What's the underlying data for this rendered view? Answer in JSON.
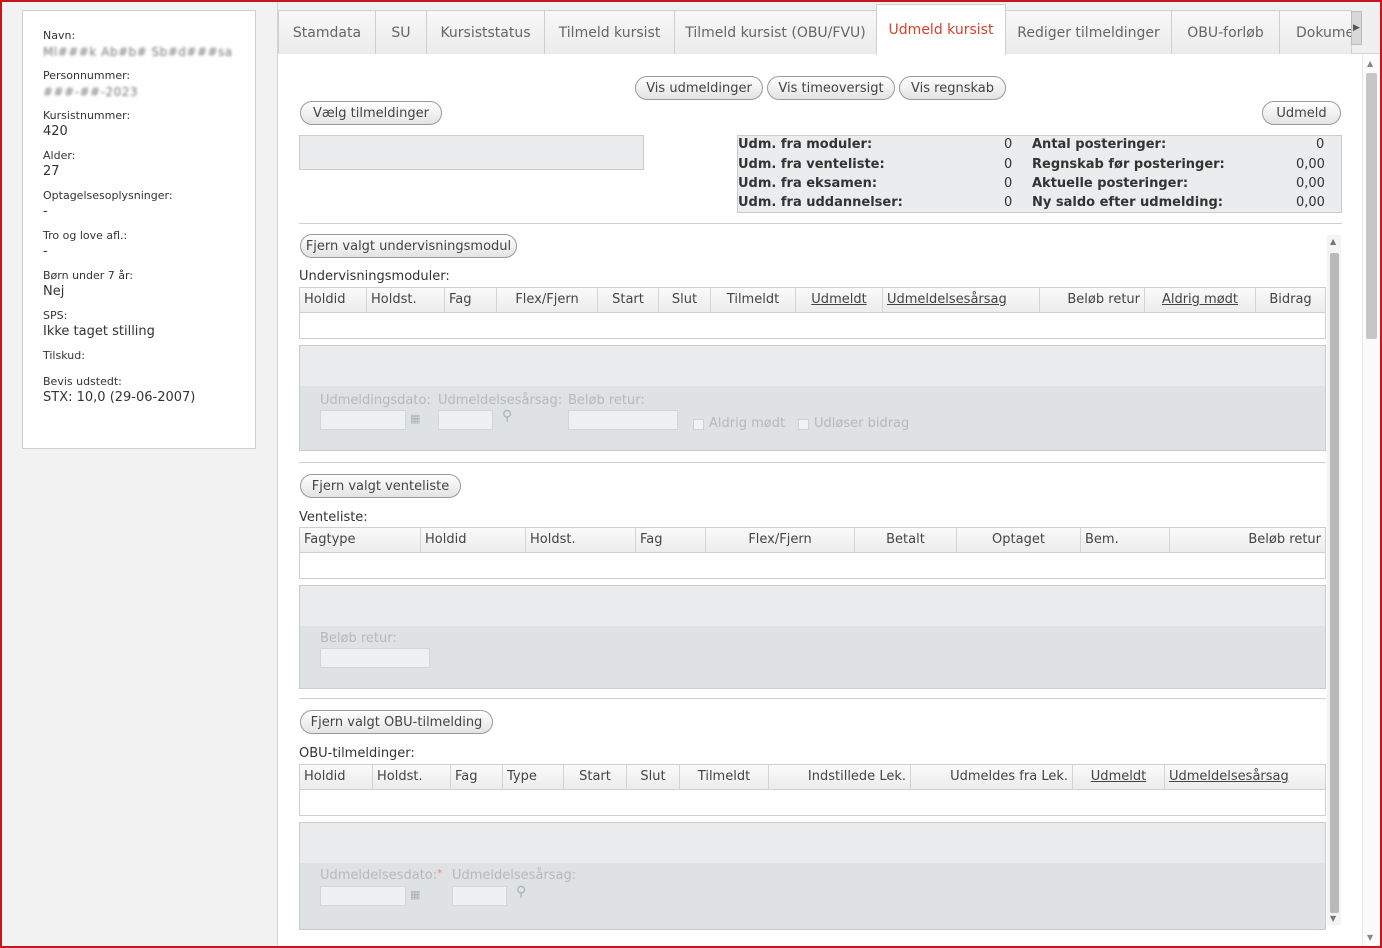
{
  "student": {
    "name_label": "Navn:",
    "name_value": "Ml###k Ab#b# Sb#d###sa",
    "cpr_label": "Personnummer:",
    "cpr_value": "###-##-2023",
    "kursist_label": "Kursistnummer:",
    "kursist_value": "420",
    "alder_label": "Alder:",
    "alder_value": "27",
    "optagelse_label": "Optagelsesoplysninger:",
    "optagelse_value": "-",
    "tro_label": "Tro og love afl.:",
    "tro_value": "-",
    "born_label": "Børn under 7 år:",
    "born_value": "Nej",
    "sps_label": "SPS:",
    "sps_value": "Ikke taget stilling",
    "tilskud_label": "Tilskud:",
    "bevis_label": "Bevis udstedt:",
    "bevis_value": "STX: 10,0 (29-06-2007)"
  },
  "tabs": {
    "stamdata": "Stamdata",
    "su": "SU",
    "kursiststatus": "Kursiststatus",
    "tilmeld": "Tilmeld kursist",
    "tilmeld_obu": "Tilmeld kursist (OBU/FVU)",
    "udmeld": "Udmeld kursist",
    "rediger": "Rediger tilmeldinger",
    "obu_forloeb": "OBU-forløb",
    "dokumenter": "Dokumenter"
  },
  "buttons": {
    "vis_udmeldinger": "Vis udmeldinger",
    "vis_timeoversigt": "Vis timeoversigt",
    "vis_regnskab": "Vis regnskab",
    "vaelg_tilmeldinger": "Vælg tilmeldinger",
    "udmeld": "Udmeld",
    "fjern_modul": "Fjern valgt undervisningsmodul",
    "fjern_venteliste": "Fjern valgt venteliste",
    "fjern_obu": "Fjern valgt OBU-tilmelding"
  },
  "summary": {
    "moduler_label": "Udm. fra moduler:",
    "moduler_value": "0",
    "venteliste_label": "Udm. fra venteliste:",
    "venteliste_value": "0",
    "eksamen_label": "Udm. fra eksamen:",
    "eksamen_value": "0",
    "uddannelser_label": "Udm. fra uddannelser:",
    "uddannelser_value": "0",
    "posteringer_label": "Antal posteringer:",
    "posteringer_value": "0",
    "regnskab_label": "Regnskab før posteringer:",
    "regnskab_value": "0,00",
    "aktuelle_label": "Aktuelle posteringer:",
    "aktuelle_value": "0,00",
    "saldo_label": "Ny saldo efter udmelding:",
    "saldo_value": "0,00"
  },
  "moduler": {
    "title": "Undervisningsmoduler:",
    "columns": [
      "Holdid",
      "Holdst.",
      "Fag",
      "Flex/Fjern",
      "Start",
      "Slut",
      "Tilmeldt",
      "Udmeldt",
      "Udmeldelsesårsag",
      "Beløb retur",
      "Aldrig mødt",
      "Bidrag"
    ],
    "form": {
      "dato_label": "Udmeldingsdato:",
      "aarsag_label": "Udmeldelsesårsag:",
      "beloeb_label": "Beløb retur:",
      "aldrig_label": "Aldrig mødt",
      "bidrag_label": "Udløser bidrag"
    }
  },
  "venteliste": {
    "title": "Venteliste:",
    "columns": [
      "Fagtype",
      "Holdid",
      "Holdst.",
      "Fag",
      "Flex/Fjern",
      "Betalt",
      "Optaget",
      "Bem.",
      "Beløb retur"
    ],
    "form": {
      "beloeb_label": "Beløb retur:"
    }
  },
  "obu": {
    "title": "OBU-tilmeldinger:",
    "columns": [
      "Holdid",
      "Holdst.",
      "Fag",
      "Type",
      "Start",
      "Slut",
      "Tilmeldt",
      "Indstillede Lek.",
      "Udmeldes fra Lek.",
      "Udmeldt",
      "Udmeldelsesårsag"
    ],
    "form": {
      "dato_label": "Udmeldelsesdato:",
      "aarsag_label": "Udmeldelsesårsag:"
    }
  },
  "icons": {
    "calendar": "calendar-icon",
    "search": "search-icon"
  },
  "colors": {
    "accent": "#d4422b",
    "frame": "#c8161d",
    "panel": "#eaeced"
  }
}
